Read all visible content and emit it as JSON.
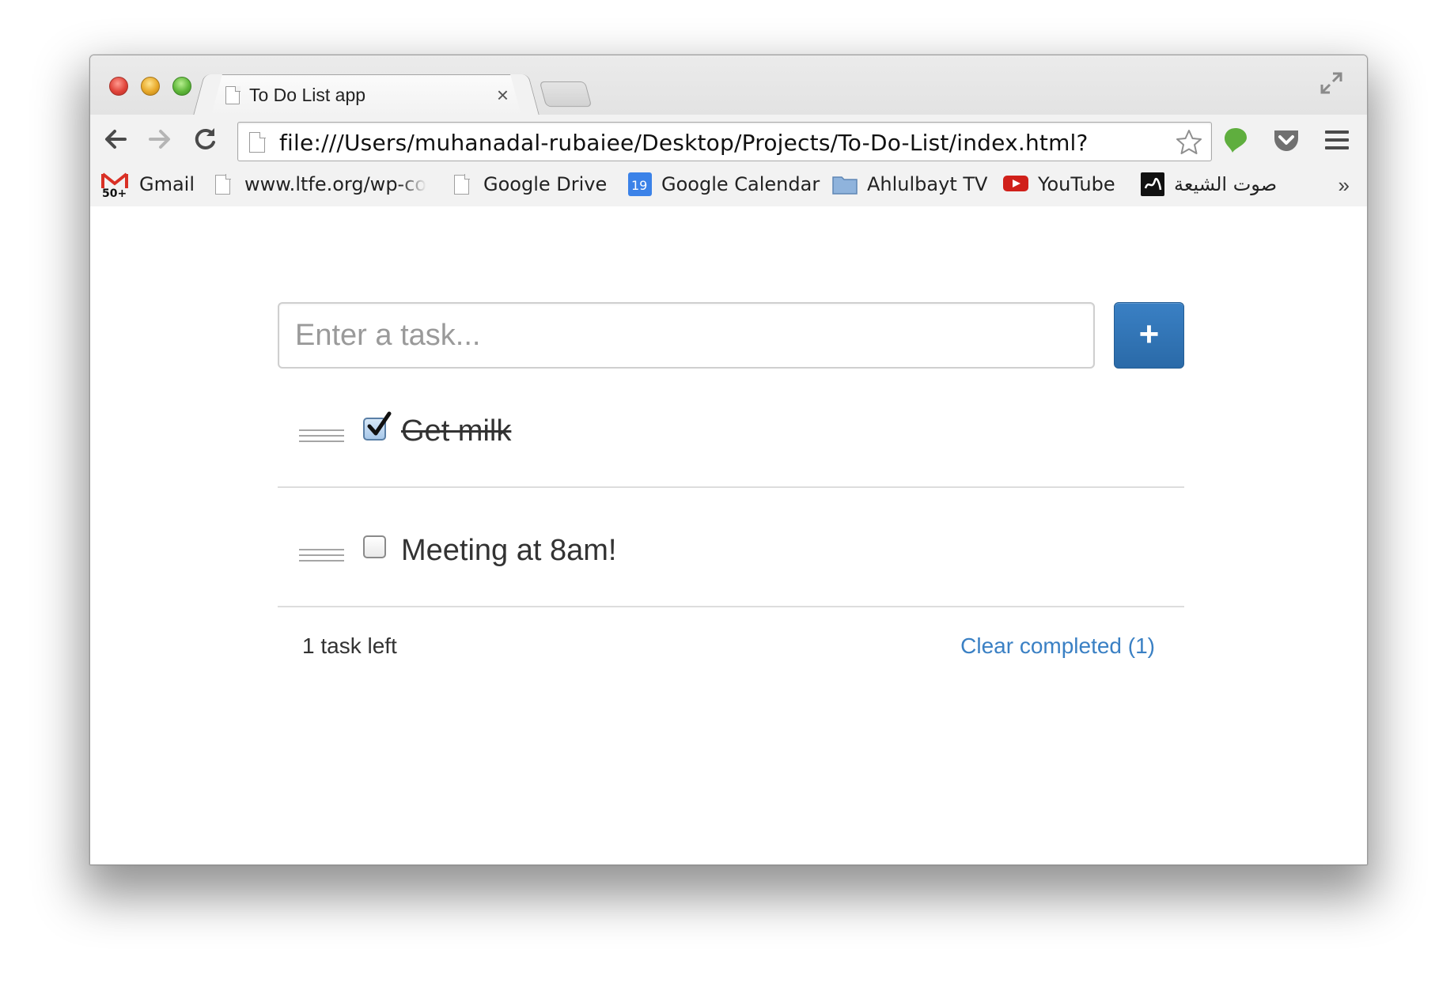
{
  "window": {
    "tab_title": "To Do List app",
    "tab_close_glyph": "×",
    "url": "file:///Users/muhanadal-rubaiee/Desktop/Projects/To-Do-List/index.html?"
  },
  "bookmarks": [
    {
      "label": "Gmail",
      "icon": "gmail-icon"
    },
    {
      "label": "www.ltfe.org/wp-cor",
      "icon": "page-icon"
    },
    {
      "label": "Google Drive",
      "icon": "page-icon"
    },
    {
      "label": "Google Calendar",
      "icon": "calendar-icon",
      "icon_text": "19"
    },
    {
      "label": "Ahlulbayt TV",
      "icon": "folder-icon"
    },
    {
      "label": "YouTube",
      "icon": "youtube-icon"
    },
    {
      "label": "صوت الشيعة",
      "icon": "site-logo-icon"
    }
  ],
  "bookmarks_overflow": "»",
  "gmail_badge": "50+",
  "todo": {
    "input_placeholder": "Enter a task...",
    "add_label": "+",
    "tasks": [
      {
        "text": "Get milk",
        "completed": true
      },
      {
        "text": "Meeting at 8am!",
        "completed": false
      }
    ],
    "count_text": "1 task left",
    "clear_text": "Clear completed (1)"
  },
  "colors": {
    "accent": "#3a80c4",
    "button_bg": "#2f72b5",
    "divider": "#dddddd"
  }
}
